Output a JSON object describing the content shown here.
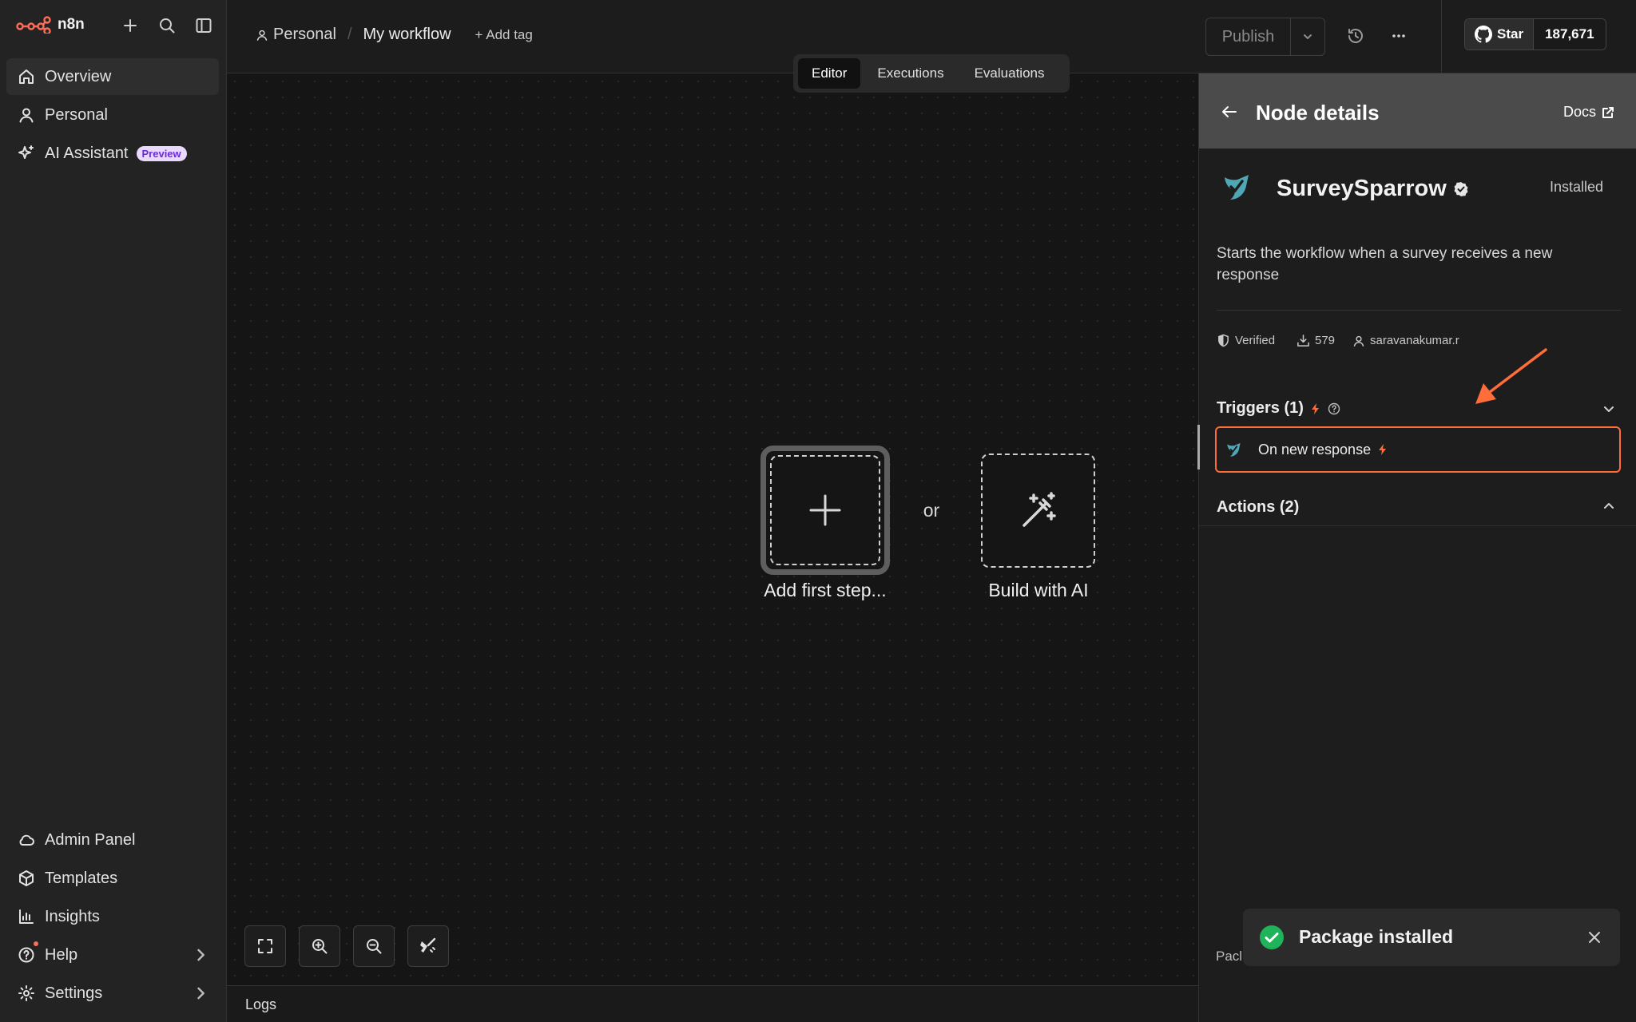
{
  "app": {
    "logo_text": "n8n"
  },
  "sidebar": {
    "items": [
      {
        "label": "Overview",
        "icon": "home-icon",
        "active": true
      },
      {
        "label": "Personal",
        "icon": "user-icon"
      },
      {
        "label": "AI Assistant",
        "icon": "sparkle-icon",
        "badge": "Preview"
      }
    ],
    "bottom_items": [
      {
        "label": "Admin Panel",
        "icon": "cloud-icon"
      },
      {
        "label": "Templates",
        "icon": "box-icon"
      },
      {
        "label": "Insights",
        "icon": "bar-chart-icon"
      },
      {
        "label": "Help",
        "icon": "help-circle-icon"
      },
      {
        "label": "Settings",
        "icon": "gear-icon"
      }
    ]
  },
  "header": {
    "breadcrumb_project": "Personal",
    "breadcrumb_separator": "/",
    "workflow_name": "My workflow",
    "add_tag": "+ Add tag",
    "tabs": [
      "Editor",
      "Executions",
      "Evaluations"
    ],
    "active_tab": "Editor",
    "publish_label": "Publish",
    "github_star_label": "Star",
    "github_star_count": "187,671"
  },
  "canvas": {
    "add_first_step": "Add first step...",
    "or": "or",
    "build_with_ai": "Build with AI",
    "logs_label": "Logs"
  },
  "panel": {
    "title": "Node details",
    "docs_label": "Docs",
    "node_name": "SurveySparrow",
    "status": "Installed",
    "description": "Starts the workflow when a survey receives a new response",
    "meta": {
      "verified": "Verified",
      "downloads": "579",
      "author": "saravanakumar.r"
    },
    "triggers_title": "Triggers (1)",
    "trigger_item": "On new response",
    "actions_title": "Actions (2)",
    "package_cut_label": "Pacl"
  },
  "toast": {
    "message": "Package installed"
  },
  "colors": {
    "accent": "#ff6d3a",
    "success": "#1fb45a",
    "badge_bg": "#e9d9ff",
    "badge_fg": "#6b2bd9"
  }
}
